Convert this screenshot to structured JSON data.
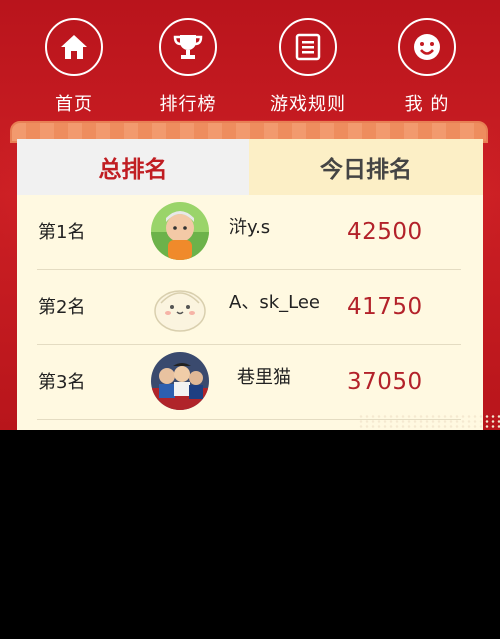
{
  "nav": {
    "items": [
      {
        "label": "首页",
        "icon": "home-icon"
      },
      {
        "label": "排行榜",
        "icon": "trophy-icon"
      },
      {
        "label": "游戏规则",
        "icon": "rules-document-icon"
      },
      {
        "label": "我 的",
        "icon": "smiley-face-icon"
      }
    ]
  },
  "tabs": {
    "total": "总排名",
    "today": "今日排名",
    "active": "total"
  },
  "ranking": [
    {
      "rank": "第1名",
      "name": "浒y.s",
      "score": "42500",
      "avatar": "baby-photo-avatar"
    },
    {
      "rank": "第2名",
      "name": "A、sk_Lee",
      "score": "41750",
      "avatar": "steamed-bun-cartoon-avatar"
    },
    {
      "rank": "第3名",
      "name": "巷里猫",
      "score": "37050",
      "avatar": "group-photo-avatar"
    }
  ],
  "colors": {
    "background_red": "#c41b22",
    "score_red": "#b3222a",
    "active_tab_text": "#c01d22",
    "card_bg": "#fff9e1"
  }
}
